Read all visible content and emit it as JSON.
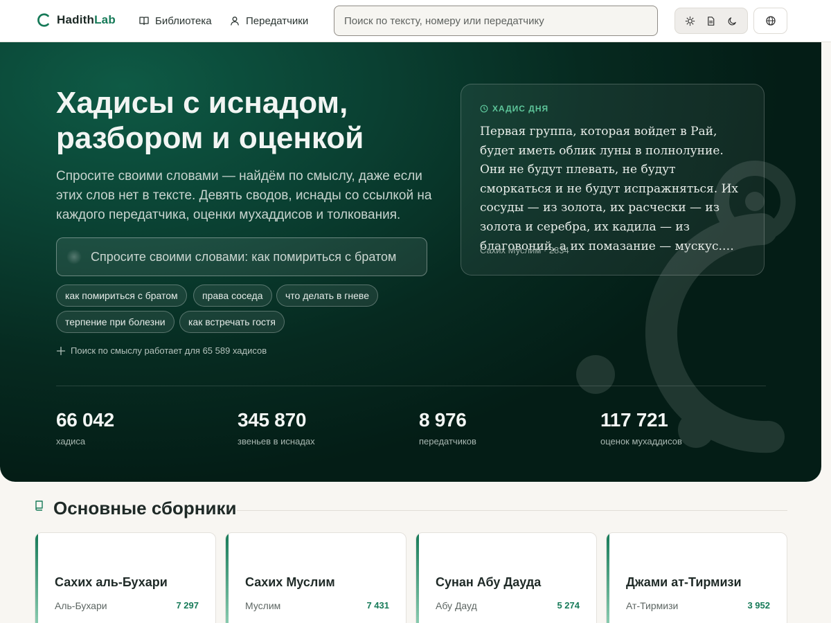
{
  "header": {
    "logo_text_a": "Hadith",
    "logo_text_b": "Lab",
    "nav": [
      {
        "label": "Библиотека",
        "icon": "book-icon"
      },
      {
        "label": "Передатчики",
        "icon": "user-icon"
      }
    ],
    "search_placeholder": "Поиск по тексту, номеру или передатчику",
    "theme_buttons": [
      "sun-icon",
      "document-icon",
      "moon-icon"
    ],
    "lang_icon": "globe-icon"
  },
  "hero": {
    "title": "Хадисы с иснадом, разбором и оценкой",
    "subtitle": "Спросите своими словами — найдём по смыслу, даже если этих слов нет в тексте. Девять сводов, иснады со ссылкой на каждого передатчика, оценки мухаддисов и толкования.",
    "ask_placeholder": "Спросите своими словами: как помириться с братом",
    "chips": [
      "как помириться с братом",
      "права соседа",
      "что делать в гневе",
      "терпение при болезни",
      "как встречать гостя"
    ],
    "semantic_note": "Поиск по смыслу работает для 65 589 хадисов",
    "stats": [
      {
        "value": "66 042",
        "label": "хадиса"
      },
      {
        "value": "345 870",
        "label": "звеньев в иснадах"
      },
      {
        "value": "8 976",
        "label": "передатчиков"
      },
      {
        "value": "117 721",
        "label": "оценок мухаддисов"
      }
    ]
  },
  "hadith_of_day": {
    "label": "ХАДИС ДНЯ",
    "text": "Первая группа, которая войдет в Рай, будет иметь облик луны в полнолуние. Они не будут плевать, не будут сморкаться и не будут испражняться. Их сосуды — из золота, их расчески — из золота и серебра, их кадила — из благовоний, а их помазание — мускус.…",
    "source": "Сахих Муслим · 2834"
  },
  "collections": {
    "title": "Основные сборники",
    "items": [
      {
        "title": "Сахих аль-Бухари",
        "author": "Аль-Бухари",
        "count": "7 297"
      },
      {
        "title": "Сахих Муслим",
        "author": "Муслим",
        "count": "7 431"
      },
      {
        "title": "Сунан Абу Дауда",
        "author": "Абу Дауд",
        "count": "5 274"
      },
      {
        "title": "Джами ат-Тирмизи",
        "author": "Ат-Тирмизи",
        "count": "3 952"
      }
    ]
  },
  "colors": {
    "brand": "#167a58",
    "hero_bg": "#0a3f31",
    "accent_label": "#5ec79b"
  }
}
